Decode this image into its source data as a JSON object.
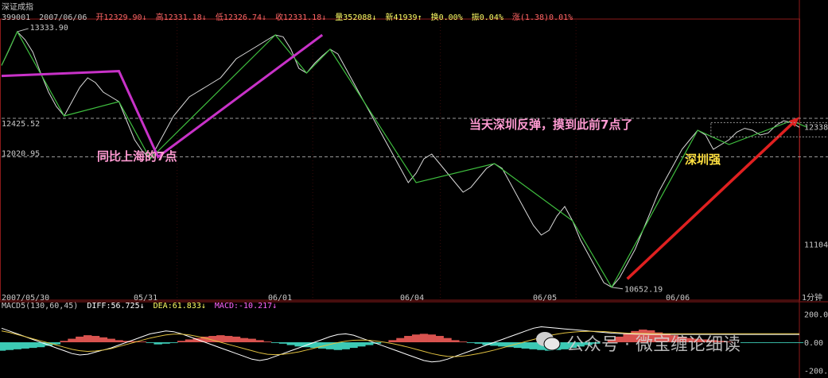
{
  "header": {
    "index_name": "深证成指",
    "code": "399001",
    "date": "2007/06/06",
    "open": "开12329.90↓",
    "high": "高12331.18↓",
    "low": "低12326.74↓",
    "close": "收12331.18↓",
    "volume": "量352088↓",
    "new": "新41939↑",
    "turnover": "换0.00%",
    "amplitude": "振0.04%",
    "change": "涨(1.38)0.01%"
  },
  "macd_header": {
    "name": "MACD5(130,60,45)",
    "diff": "DIFF:56.725↓",
    "dea": "DEA:61.833↓",
    "macd": "MACD:-10.217↓"
  },
  "annotations": {
    "left_note": "同比上海的7点",
    "right_note": "当天深圳反弹，摸到此前7点了",
    "strong_note": "深圳强"
  },
  "watermark": "公众号 · 微宝缠论细读",
  "colors": {
    "background": "#000000",
    "price_line": "#d9d9d9",
    "zigzag": "#3fbf3f",
    "magenta": "#c832c8",
    "arrow": "#e02020",
    "macd_pos": "#d9534f",
    "macd_neg": "#3cc9b4",
    "diff_line": "#ffffff",
    "dea_line": "#e0c040",
    "grid": "#8b1a1a",
    "annot_pink": "#ff9ad2",
    "annot_yellow": "#ffe040"
  },
  "chart_data": {
    "type": "line",
    "title": "深证成指",
    "x_labels": [
      "2007/05/30",
      "05/31",
      "06/01",
      "06/04",
      "06/05",
      "06/06",
      "1分钟"
    ],
    "ylim": [
      10600,
      13450
    ],
    "y_axis_labels": [
      {
        "value": 12338,
        "text": "12338"
      },
      {
        "value": 11104,
        "text": "11104"
      }
    ],
    "reference_lines": [
      {
        "value": 12425.52,
        "text": "12425.52"
      },
      {
        "value": 12020.95,
        "text": "12020.95"
      }
    ],
    "high_low_labels": [
      {
        "value": 13333.9,
        "text": "13333.90"
      },
      {
        "value": 10652.19,
        "text": "10652.19"
      }
    ],
    "series": [
      {
        "values": [
          12980,
          13150,
          13333.9,
          13250,
          13120,
          12900,
          12700,
          12550,
          12450,
          12600,
          12750,
          12850,
          12800,
          12700,
          12650,
          12600,
          12400,
          12200,
          12080,
          12000,
          12150,
          12300,
          12450,
          12550,
          12650,
          12700,
          12750,
          12800,
          12850,
          12950,
          13050,
          13100,
          13150,
          13200,
          13250,
          13300,
          13280,
          13150,
          12950,
          12900,
          13000,
          13080,
          13150,
          13100,
          12950,
          12800,
          12650,
          12500,
          12350,
          12200,
          12050,
          11900,
          11750,
          11850,
          12000,
          12050,
          11950,
          11850,
          11750,
          11650,
          11700,
          11800,
          11900,
          11950,
          11900,
          11750,
          11600,
          11450,
          11300,
          11200,
          11250,
          11400,
          11500,
          11350,
          11150,
          11000,
          10850,
          10700,
          10652.19,
          10750,
          10900,
          11050,
          11250,
          11450,
          11650,
          11800,
          11950,
          12100,
          12200,
          12300,
          12250,
          12100,
          12150,
          12200,
          12280,
          12320,
          12300,
          12250,
          12270,
          12350,
          12400,
          12380,
          12331.18
        ]
      }
    ],
    "zigzag": [
      [
        0,
        12980
      ],
      [
        2,
        13333.9
      ],
      [
        8,
        12450
      ],
      [
        15,
        12600
      ],
      [
        19,
        12000
      ],
      [
        35,
        13300
      ],
      [
        39,
        12900
      ],
      [
        42,
        13150
      ],
      [
        53,
        11750
      ],
      [
        63,
        11950
      ],
      [
        73,
        11350
      ],
      [
        78,
        10652.19
      ],
      [
        89,
        12300
      ],
      [
        93,
        12150
      ],
      [
        101,
        12400
      ],
      [
        103,
        12331.18
      ]
    ],
    "magenta_line": [
      [
        0,
        12870
      ],
      [
        15,
        12920
      ],
      [
        20,
        12020
      ],
      [
        41,
        13300
      ]
    ],
    "arrow": {
      "from": [
        80,
        10740
      ],
      "to": [
        102,
        12440
      ]
    },
    "macd": {
      "ylim": [
        -220,
        220
      ],
      "y_labels": [
        200.0,
        0.0,
        -200.0
      ],
      "histogram": [
        -60,
        -55,
        -50,
        -45,
        -40,
        -35,
        -25,
        -15,
        10,
        25,
        40,
        50,
        45,
        35,
        25,
        15,
        10,
        8,
        5,
        -5,
        -15,
        -10,
        -5,
        10,
        20,
        30,
        40,
        45,
        50,
        45,
        40,
        30,
        25,
        15,
        5,
        -5,
        -10,
        -20,
        -30,
        -35,
        -40,
        -45,
        -50,
        -55,
        -50,
        -40,
        -30,
        -20,
        -10,
        0,
        15,
        30,
        45,
        55,
        60,
        55,
        45,
        30,
        15,
        5,
        -5,
        -10,
        -20,
        -25,
        -30,
        -35,
        -40,
        -45,
        -50,
        -55,
        -60,
        -55,
        -50,
        -40,
        -30,
        -20,
        -10,
        0,
        20,
        40,
        60,
        80,
        90,
        85,
        70,
        60,
        50,
        40,
        30,
        25,
        20,
        15,
        10,
        5,
        0,
        -5,
        -5,
        -5,
        -5,
        -5,
        -5,
        -5,
        -5
      ],
      "diff": [
        100,
        80,
        60,
        40,
        20,
        0,
        -20,
        -40,
        -60,
        -80,
        -90,
        -85,
        -70,
        -55,
        -40,
        -20,
        0,
        20,
        40,
        60,
        70,
        80,
        75,
        60,
        40,
        20,
        0,
        -20,
        -40,
        -60,
        -80,
        -100,
        -120,
        -130,
        -120,
        -100,
        -80,
        -60,
        -40,
        -20,
        0,
        20,
        40,
        55,
        60,
        50,
        30,
        10,
        -10,
        -30,
        -50,
        -70,
        -90,
        -110,
        -130,
        -140,
        -135,
        -120,
        -100,
        -80,
        -60,
        -40,
        -20,
        0,
        20,
        40,
        60,
        80,
        100,
        110,
        105,
        100,
        95,
        90,
        85,
        80,
        75,
        70,
        65,
        62,
        60,
        58,
        56.725,
        56,
        56,
        56,
        56,
        56,
        56,
        56,
        56,
        56,
        56,
        56,
        56,
        56,
        56,
        56,
        56,
        56,
        56,
        56,
        56
      ],
      "dea": [
        80,
        70,
        55,
        40,
        25,
        10,
        -5,
        -20,
        -35,
        -50,
        -60,
        -65,
        -62,
        -55,
        -45,
        -30,
        -15,
        0,
        15,
        30,
        42,
        52,
        58,
        58,
        52,
        42,
        30,
        15,
        0,
        -15,
        -30,
        -45,
        -60,
        -75,
        -85,
        -88,
        -85,
        -78,
        -68,
        -55,
        -42,
        -28,
        -15,
        -2,
        8,
        14,
        16,
        14,
        8,
        0,
        -10,
        -22,
        -35,
        -50,
        -65,
        -80,
        -92,
        -100,
        -102,
        -98,
        -90,
        -80,
        -68,
        -55,
        -40,
        -25,
        -10,
        5,
        20,
        35,
        48,
        58,
        66,
        72,
        76,
        78,
        78,
        76,
        72,
        68,
        65,
        63,
        61.833,
        61.5,
        61.2,
        61,
        61,
        61,
        61,
        61,
        61,
        61,
        61,
        61,
        61,
        61,
        61,
        61,
        61,
        61,
        61,
        61,
        61
      ]
    }
  }
}
